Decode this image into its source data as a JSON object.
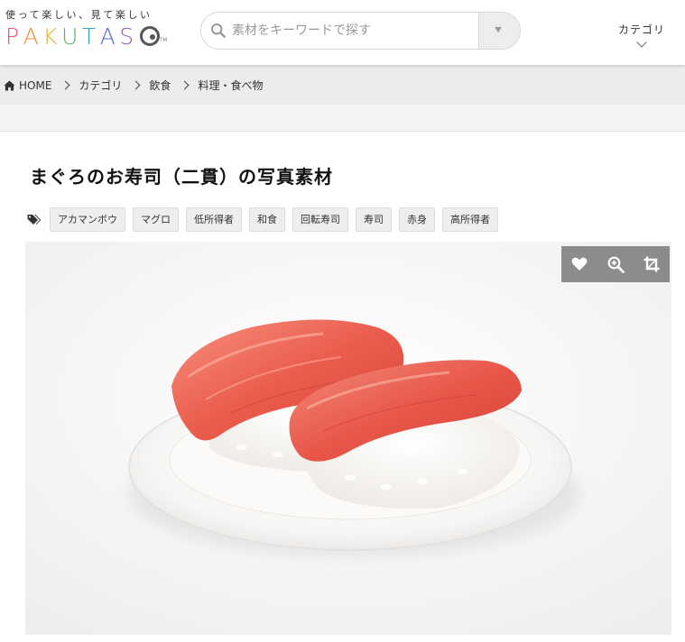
{
  "header": {
    "tagline": "使って楽しい、見て楽しい",
    "logo_letters": [
      {
        "char": "P",
        "color": "#e9546b"
      },
      {
        "char": "A",
        "color": "#f08c39"
      },
      {
        "char": "K",
        "color": "#e8b43a"
      },
      {
        "char": "U",
        "color": "#5bb36a"
      },
      {
        "char": "T",
        "color": "#3aa0c8"
      },
      {
        "char": "A",
        "color": "#5a6fc0"
      },
      {
        "char": "S",
        "color": "#8d5bb0"
      }
    ],
    "trademark": "TM",
    "search": {
      "placeholder": "素材をキーワードで探す",
      "value": ""
    },
    "category_menu": "カテゴリ"
  },
  "breadcrumb": {
    "items": [
      "HOME",
      "カテゴリ",
      "飲食",
      "料理・食べ物"
    ]
  },
  "page": {
    "title": "まぐろのお寿司（二貫）の写真素材",
    "tags": [
      "アカマンボウ",
      "マグロ",
      "低所得者",
      "和食",
      "回転寿司",
      "寿司",
      "赤身",
      "高所得者"
    ]
  },
  "photo": {
    "subject": "two pieces of tuna nigiri on a white plate",
    "actions": [
      "heart-icon",
      "zoom-in-icon",
      "crop-icon"
    ]
  },
  "colors": {
    "header_bg": "#ffffff",
    "breadcrumb_bg": "#ececec",
    "tag_bg": "#eeeeee",
    "action_bar": "#6e6e6e"
  }
}
